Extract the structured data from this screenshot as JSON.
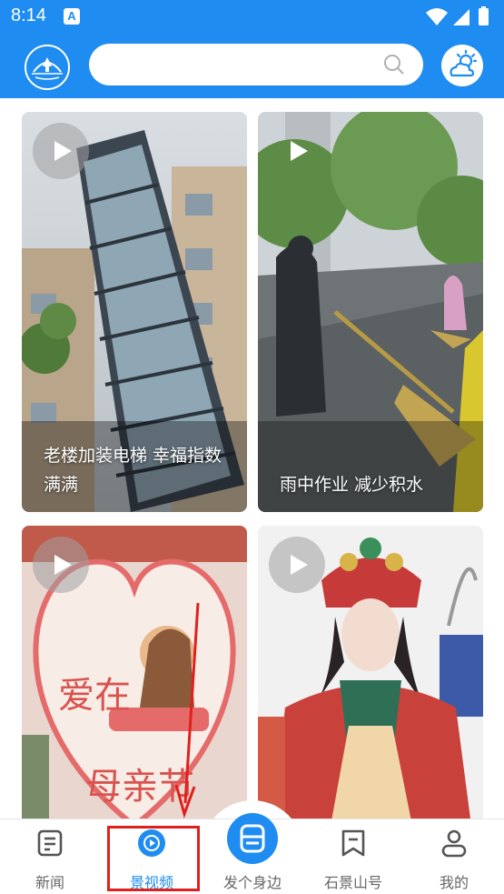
{
  "status": {
    "time": "8:14",
    "notif_icon": "A"
  },
  "header": {
    "logo_icon": "city-logo-icon",
    "search_placeholder": "",
    "weather_icon": "weather-icon"
  },
  "feed": {
    "items": [
      {
        "title": "老楼加装电梯 幸福指数满满",
        "thumb": "elevator-building"
      },
      {
        "title": "雨中作业 减少积水",
        "thumb": "rain-street-sweeping"
      },
      {
        "title": "",
        "thumb": "mothers-day-heart"
      },
      {
        "title": "",
        "thumb": "opera-costume"
      }
    ]
  },
  "bottom_nav": {
    "items": [
      {
        "label": "新闻",
        "icon": "news-icon"
      },
      {
        "label": "景视频",
        "icon": "video-icon",
        "active": true
      },
      {
        "label": "发个身边",
        "icon": "post-icon"
      },
      {
        "label": "石景山号",
        "icon": "bookmark-icon"
      },
      {
        "label": "我的",
        "icon": "profile-icon"
      }
    ]
  },
  "colors": {
    "brand": "#1e8cf0",
    "highlight": "#e0201c"
  }
}
